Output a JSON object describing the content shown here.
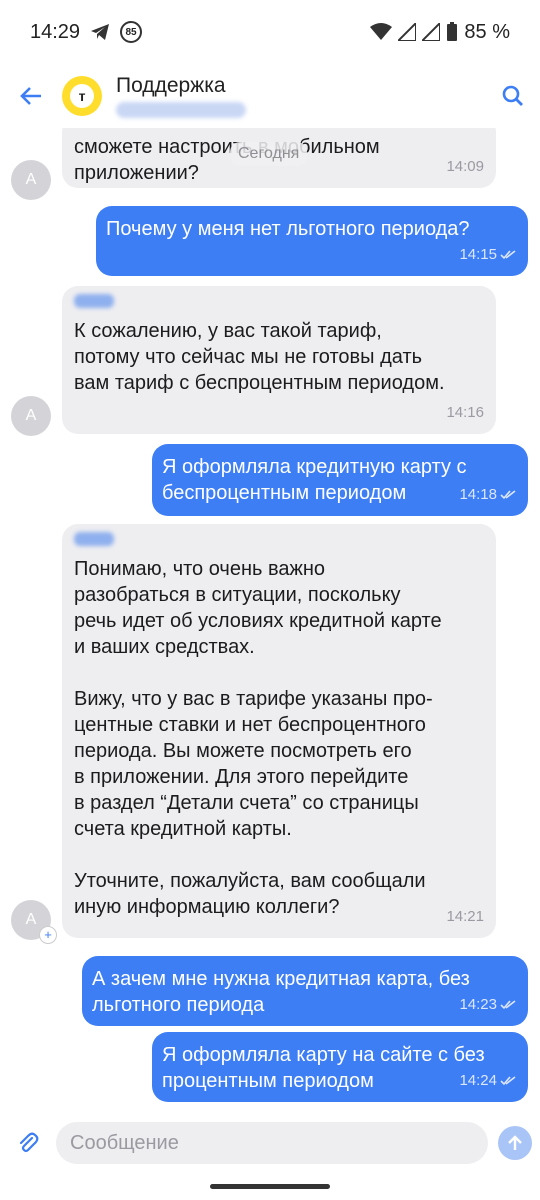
{
  "status_bar": {
    "time": "14:29",
    "badge": "85",
    "battery": "85 %"
  },
  "header": {
    "title": "Поддержка",
    "logo_letter": "т"
  },
  "chat": {
    "date_label": "Сегодня",
    "messages": [
      {
        "dir": "in",
        "text": "сможете настроить в мобильном\nприложении?",
        "time": "14:09",
        "avatar": "A"
      },
      {
        "dir": "out",
        "text": "Почему у меня нет льготного периода?",
        "time": "14:15"
      },
      {
        "dir": "in",
        "text": "К сожалению, у вас такой тариф,\nпотому что сейчас мы не готовы дать\nвам тариф с беспроцентным периодом.",
        "time": "14:16",
        "avatar": "A"
      },
      {
        "dir": "out",
        "text": "Я оформляла кредитную карту с\nбеспроцентным периодом",
        "time": "14:18"
      },
      {
        "dir": "in",
        "text": "Понимаю, что очень важно\nразобраться в ситуации, поскольку\nречь идет об условиях кредитной карте\nи ваших средствах.\n\nВижу, что у вас в тарифе указаны про-\nцентные ставки и нет беспроцентного\nпериода. Вы можете посмотреть его\nв приложении. Для этого перейдите\nв раздел “Детали счета” со страницы\nсчета кредитной карты.\n\nУточните, пожалуйста, вам сообщали\nиную информацию коллеги?",
        "time": "14:21",
        "avatar": "A"
      },
      {
        "dir": "out",
        "text": "А зачем мне нужна кредитная карта, без\nльготного периода",
        "time": "14:23"
      },
      {
        "dir": "out",
        "text": "Я оформляла карту на сайте с без\nпроцентным периодом",
        "time": "14:24"
      }
    ]
  },
  "input": {
    "placeholder": "Сообщение"
  },
  "colors": {
    "accent": "#3d7ef5",
    "incoming": "#eeeef1",
    "logo": "#ffdd2d"
  }
}
